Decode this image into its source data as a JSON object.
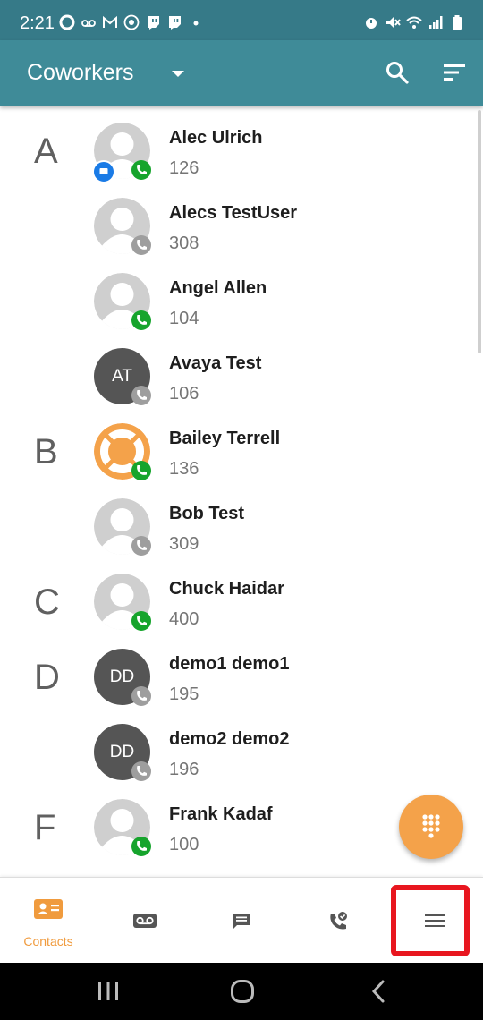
{
  "status_bar": {
    "time": "2:21"
  },
  "app_bar": {
    "title": "Coworkers"
  },
  "colors": {
    "primary": "#3f8b98",
    "status_bar": "#367a88",
    "accent": "#f4a24a",
    "online_green": "#16a42c",
    "offline_gray": "#9e9e9e",
    "chat_blue": "#1a7be6",
    "highlight_red": "#e8161f"
  },
  "contacts": [
    {
      "letter": "A",
      "name": "Alec Ulrich",
      "ext": "126",
      "avatar": "placeholder",
      "presence": "available",
      "chat_badge": true
    },
    {
      "letter": "",
      "name": "Alecs TestUser",
      "ext": "308",
      "avatar": "placeholder",
      "presence": "offline",
      "chat_badge": false
    },
    {
      "letter": "",
      "name": "Angel Allen",
      "ext": "104",
      "avatar": "placeholder",
      "presence": "available",
      "chat_badge": false
    },
    {
      "letter": "",
      "name": "Avaya Test",
      "ext": "106",
      "avatar": "initials",
      "initials": "AT",
      "presence": "offline",
      "chat_badge": false
    },
    {
      "letter": "B",
      "name": "Bailey Terrell",
      "ext": "136",
      "avatar": "lifebuoy",
      "presence": "available",
      "chat_badge": false
    },
    {
      "letter": "",
      "name": "Bob Test",
      "ext": "309",
      "avatar": "placeholder",
      "presence": "offline",
      "chat_badge": false
    },
    {
      "letter": "C",
      "name": "Chuck Haidar",
      "ext": "400",
      "avatar": "placeholder",
      "presence": "available",
      "chat_badge": false
    },
    {
      "letter": "D",
      "name": "demo1 demo1",
      "ext": "195",
      "avatar": "initials",
      "initials": "DD",
      "presence": "offline",
      "chat_badge": false
    },
    {
      "letter": "",
      "name": "demo2 demo2",
      "ext": "196",
      "avatar": "initials",
      "initials": "DD",
      "presence": "offline",
      "chat_badge": false
    },
    {
      "letter": "F",
      "name": "Frank Kadaf",
      "ext": "100",
      "avatar": "placeholder",
      "presence": "available",
      "chat_badge": false
    }
  ],
  "bottom_nav": {
    "items": [
      {
        "icon": "contact-card-icon",
        "label": "Contacts",
        "active": true
      },
      {
        "icon": "voicemail-icon",
        "label": "",
        "active": false
      },
      {
        "icon": "chat-bubble-icon",
        "label": "",
        "active": false
      },
      {
        "icon": "call-history-icon",
        "label": "",
        "active": false
      },
      {
        "icon": "menu-icon",
        "label": "",
        "active": false
      }
    ]
  }
}
